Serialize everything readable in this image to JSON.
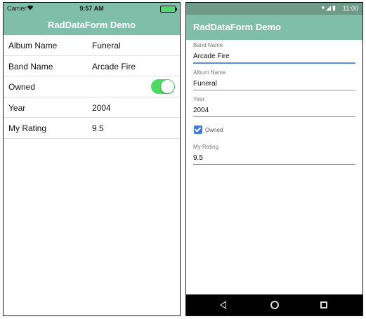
{
  "ios": {
    "status": {
      "carrier": "Carrier",
      "wifi_icon": "wifi-icon",
      "time": "9:57 AM"
    },
    "nav_title": "RadDataForm Demo",
    "rows": [
      {
        "label": "Album Name",
        "value": "Funeral"
      },
      {
        "label": "Band Name",
        "value": "Arcade Fire"
      },
      {
        "label": "Owned",
        "value": ""
      },
      {
        "label": "Year",
        "value": "2004"
      },
      {
        "label": "My Rating",
        "value": "9.5"
      }
    ],
    "owned": true,
    "toggle_color": "#4cd964"
  },
  "android": {
    "status": {
      "time": "11:00",
      "icons": "▾◢▮"
    },
    "toolbar_title": "RadDataForm Demo",
    "fields": [
      {
        "label": "Band Name",
        "value": "Arcade Fire",
        "focused": true
      },
      {
        "label": "Album Name",
        "value": "Funeral"
      },
      {
        "label": "Year",
        "value": "2004"
      },
      {
        "label": "My Rating",
        "value": "9.5"
      }
    ],
    "owned_label": "Owned",
    "owned": true,
    "accent_color": "#3f7be0"
  },
  "colors": {
    "header": "#7fbfaa",
    "android_status": "#6d9a89"
  }
}
